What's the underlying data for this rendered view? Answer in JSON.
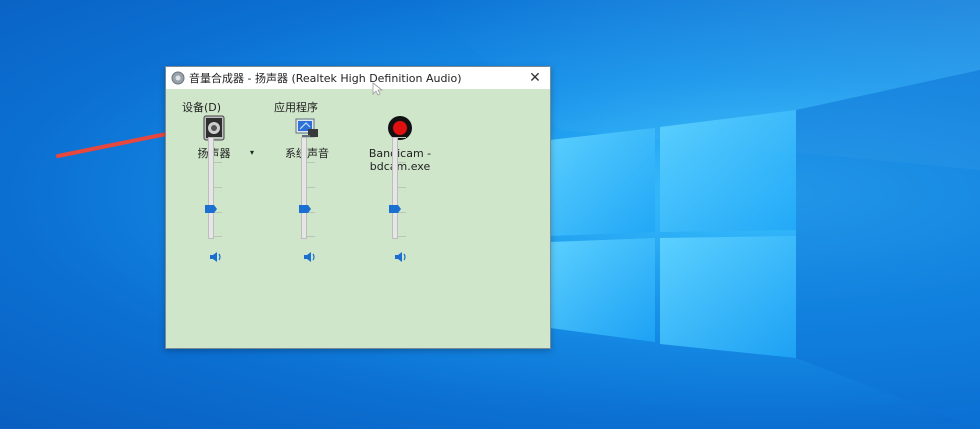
{
  "window": {
    "title": "音量合成器 - 扬声器 (Realtek High Definition Audio)",
    "close_glyph": "✕"
  },
  "sections": {
    "devices_label": "设备(D)",
    "apps_label": "应用程序"
  },
  "channels": [
    {
      "name": "扬声器",
      "icon": "speaker-device-icon",
      "volume_percent": 28,
      "has_dropdown": true
    },
    {
      "name": "系统声音",
      "icon": "system-sounds-icon",
      "volume_percent": 28
    },
    {
      "name": "Bandicam -\nbdcam.exe",
      "icon": "bandicam-record-icon",
      "volume_percent": 28
    }
  ],
  "dropdown_glyph": "▾",
  "colors": {
    "window_bg": "#cfe6cb",
    "thumb": "#1a6fd0",
    "arrow": "#e8473e",
    "bandicam": "#e01010"
  }
}
